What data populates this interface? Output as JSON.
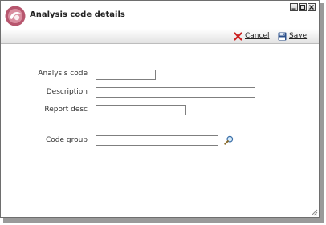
{
  "window": {
    "title": "Analysis code details",
    "controls": [
      "minimize",
      "maximize",
      "close"
    ]
  },
  "toolbar": {
    "cancel_label": "Cancel",
    "save_label": "Save"
  },
  "form": {
    "analysis_code": {
      "label": "Analysis code",
      "value": ""
    },
    "description": {
      "label": "Description",
      "value": ""
    },
    "report_desc": {
      "label": "Report desc",
      "value": ""
    },
    "code_group": {
      "label": "Code group",
      "value": ""
    }
  },
  "icons": {
    "logo": "app-logo-icon",
    "cancel": "red-x-icon",
    "save": "floppy-disk-icon",
    "lookup": "magnifier-icon"
  },
  "colors": {
    "logo_primary": "#b7566e",
    "cancel_icon": "#cc2222",
    "save_icon": "#2b4f8a"
  }
}
